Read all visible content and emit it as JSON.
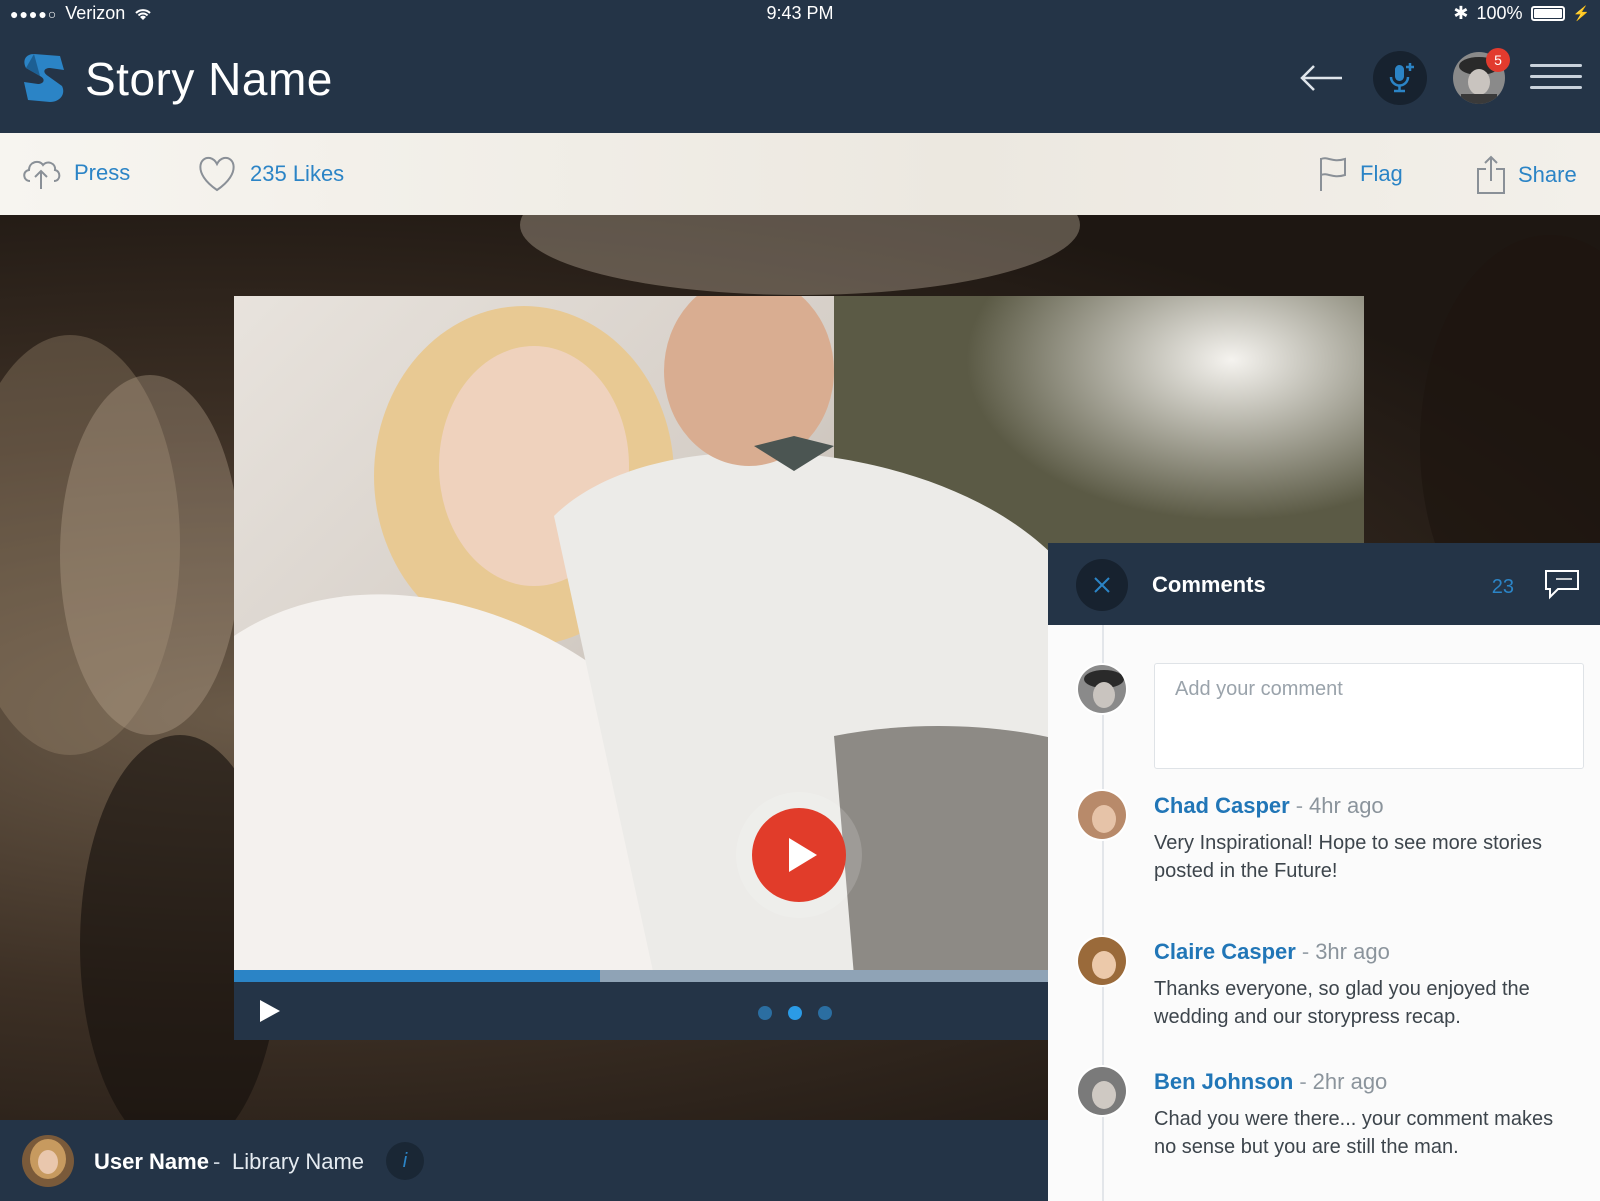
{
  "status_bar": {
    "carrier": "Verizon",
    "time": "9:43 PM",
    "battery": "100%"
  },
  "header": {
    "title": "Story Name",
    "notifications": "5"
  },
  "actions": {
    "press": "Press",
    "likes": "235 Likes",
    "flag": "Flag",
    "share": "Share"
  },
  "player": {
    "progress": 0.45,
    "slides": 3,
    "active_slide": 1
  },
  "footer": {
    "user_name": "User Name",
    "separator": "-",
    "library_name": "Library Name",
    "info": "i"
  },
  "comments": {
    "title": "Comments",
    "count": "23",
    "placeholder": "Add your comment",
    "items": [
      {
        "name": "Chad Casper",
        "sep": "-",
        "time": "4hr ago",
        "text": "Very Inspirational! Hope to see more stories posted in the Future!"
      },
      {
        "name": "Claire Casper",
        "sep": "-",
        "time": "3hr ago",
        "text": "Thanks everyone, so glad you enjoyed the wedding and our storypress recap."
      },
      {
        "name": "Ben Johnson",
        "sep": "-",
        "time": "2hr ago",
        "text": "Chad you were there... your comment makes no sense but you are still the man."
      }
    ]
  },
  "colors": {
    "navy": "#243447",
    "accent": "#2b84c6",
    "play": "#e13c2a",
    "badge": "#e23b2e"
  }
}
